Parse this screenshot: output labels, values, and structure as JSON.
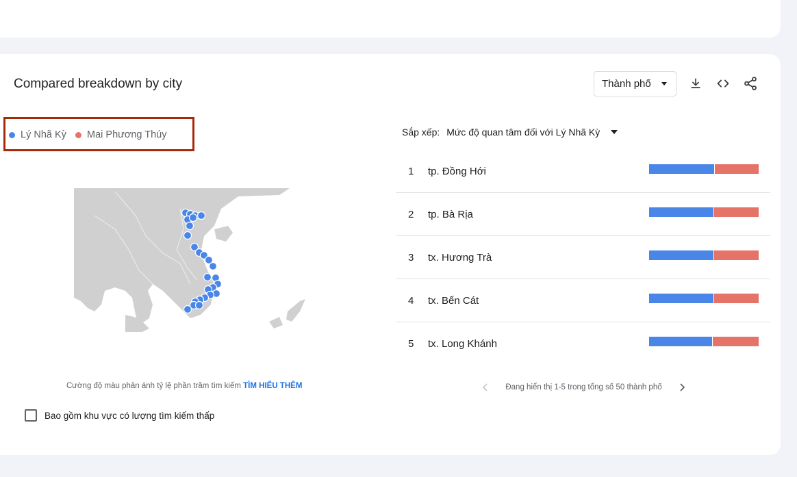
{
  "card": {
    "title": "Compared breakdown by city",
    "geo_select": "Thành phố"
  },
  "icons": {
    "download": "download-icon",
    "embed": "embed-code-icon",
    "share": "share-icon"
  },
  "legend": [
    {
      "label": "Lý Nhã Kỳ",
      "color": "#4a86e8"
    },
    {
      "label": "Mai Phương Thúy",
      "color": "#e57368"
    }
  ],
  "sort": {
    "label": "Sắp xếp:",
    "value": "Mức độ quan tâm đối với Lý Nhã Kỳ"
  },
  "rows": [
    {
      "rank": "1",
      "city": "tp. Đồng Hới",
      "share_a": 0.6,
      "share_b": 0.4
    },
    {
      "rank": "2",
      "city": "tp. Bà Rịa",
      "share_a": 0.59,
      "share_b": 0.41
    },
    {
      "rank": "3",
      "city": "tx. Hương Trà",
      "share_a": 0.59,
      "share_b": 0.41
    },
    {
      "rank": "4",
      "city": "tx. Bến Cát",
      "share_a": 0.59,
      "share_b": 0.41
    },
    {
      "rank": "5",
      "city": "tx. Long Khánh",
      "share_a": 0.58,
      "share_b": 0.42
    }
  ],
  "map": {
    "note": "Cường độ màu phản ánh tỷ lệ phần trăm tìm kiếm",
    "learn_more": "TÌM HIỂU THÊM"
  },
  "low_volume": {
    "label": "Bao gồm khu vực có lượng tìm kiếm thấp",
    "checked": false
  },
  "pager": {
    "text": "Đang hiển thị 1-5 trong tổng số 50 thành phố"
  }
}
